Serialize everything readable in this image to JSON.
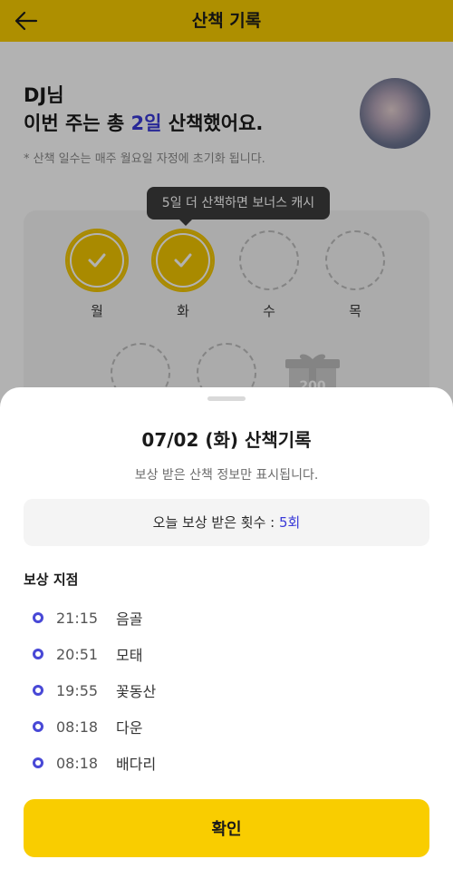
{
  "header": {
    "title": "산책 기록"
  },
  "summary": {
    "greeting_name": "DJ님",
    "week_text_prefix": "이번 주는 총 ",
    "week_count": "2일",
    "week_text_suffix": " 산책했어요.",
    "note": "* 산책 일수는 매주 월요일 자정에 초기화 됩니다.",
    "tooltip": "5일 더 산책하면 보너스 캐시",
    "days": [
      {
        "label": "월",
        "done": true
      },
      {
        "label": "화",
        "done": true
      },
      {
        "label": "수",
        "done": false
      },
      {
        "label": "목",
        "done": false
      }
    ],
    "gift_amount": "200"
  },
  "sheet": {
    "title": "07/02 (화) 산책기록",
    "subtitle": "보상 받은 산책 정보만 표시됩니다.",
    "count_label": "오늘 보상 받은 횟수 : ",
    "count_value": "5회",
    "points_title": "보상 지점",
    "points": [
      {
        "time": "21:15",
        "place": "음골"
      },
      {
        "time": "20:51",
        "place": "모태"
      },
      {
        "time": "19:55",
        "place": "꽃동산"
      },
      {
        "time": "08:18",
        "place": "다운"
      },
      {
        "time": "08:18",
        "place": "배다리"
      }
    ],
    "confirm_label": "확인"
  },
  "colors": {
    "brand_yellow": "#f9cd00",
    "accent_blue": "#3a3ad8"
  },
  "icons": {
    "back": "arrow-left-icon",
    "check": "check-icon",
    "gift": "gift-icon"
  }
}
